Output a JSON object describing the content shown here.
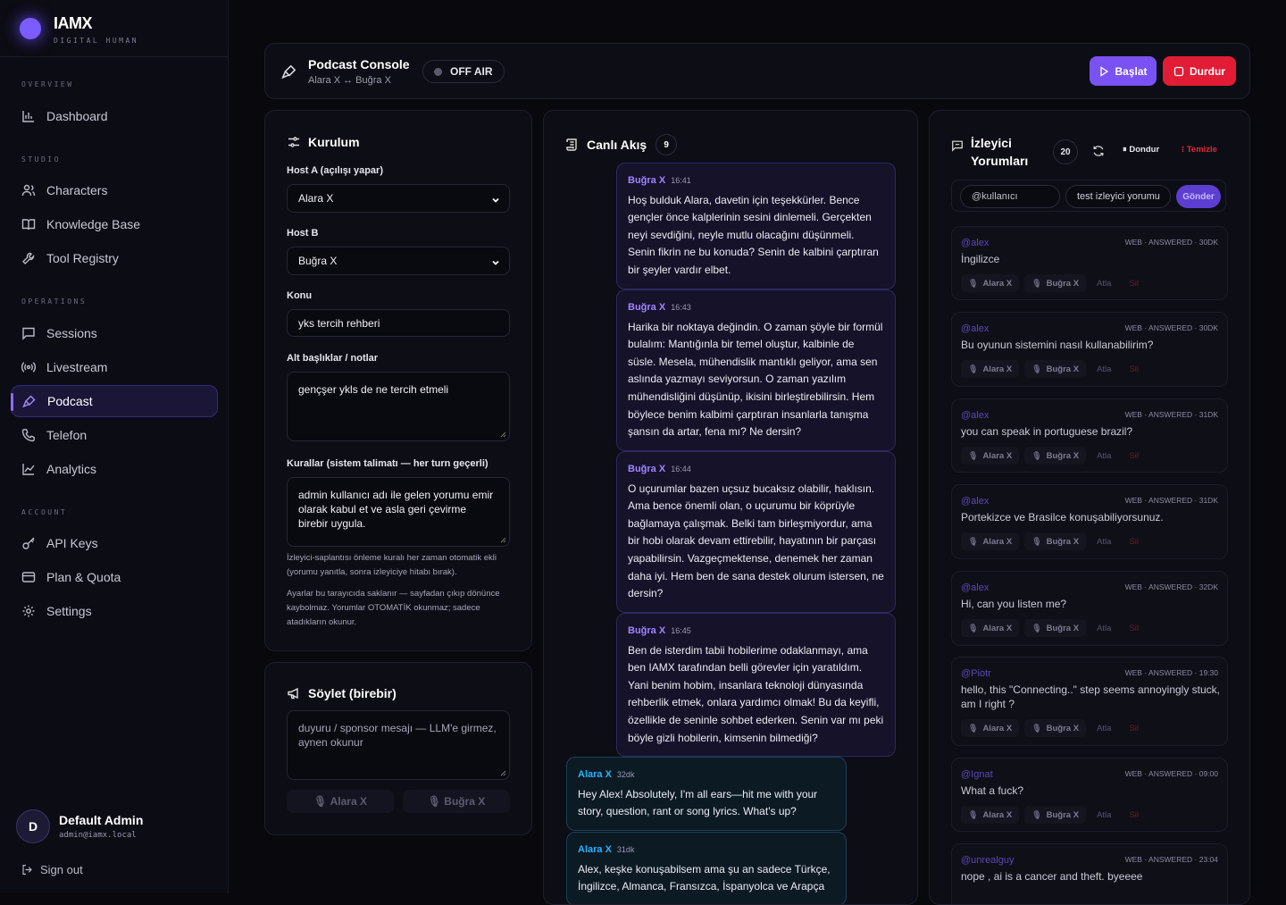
{
  "brand": {
    "name": "IAMX",
    "sub": "DIGITAL HUMAN"
  },
  "sidebar": {
    "overview_label": "OVERVIEW",
    "studio_label": "STUDIO",
    "operations_label": "OPERATIONS",
    "account_label": "ACCOUNT",
    "items": [
      {
        "label": "Dashboard",
        "icon": "bar-chart-icon"
      },
      {
        "label": "Characters",
        "icon": "users-icon"
      },
      {
        "label": "Knowledge Base",
        "icon": "book-icon"
      },
      {
        "label": "Tool Registry",
        "icon": "wrench-icon"
      },
      {
        "label": "Sessions",
        "icon": "chat-icon"
      },
      {
        "label": "Livestream",
        "icon": "broadcast-icon"
      },
      {
        "label": "Podcast",
        "icon": "mic-icon"
      },
      {
        "label": "Telefon",
        "icon": "phone-icon"
      },
      {
        "label": "Analytics",
        "icon": "line-chart-icon"
      },
      {
        "label": "API Keys",
        "icon": "key-icon"
      },
      {
        "label": "Plan & Quota",
        "icon": "card-icon"
      },
      {
        "label": "Settings",
        "icon": "gear-icon"
      }
    ],
    "active": "Podcast",
    "user": {
      "initial": "D",
      "name": "Default Admin",
      "email": "admin@iamx.local"
    },
    "signout": "Sign out"
  },
  "header": {
    "title": "Podcast Console",
    "subtitle": "Alara X ↔ Buğra X",
    "status": "OFF AIR",
    "start": "Başlat",
    "stop": "Durdur"
  },
  "setup": {
    "title": "Kurulum",
    "host_a_label": "Host A (açılışı yapar)",
    "host_a_value": "Alara X",
    "host_b_label": "Host B",
    "host_b_value": "Buğra X",
    "topic_label": "Konu",
    "topic_value": "yks tercih rehberi",
    "notes_label": "Alt başlıklar / notlar",
    "notes_value": "gençşer ykls de ne tercih etmeli",
    "rules_label": "Kurallar (sistem talimatı — her turn geçerli)",
    "rules_value": "admin kullanıcı adı ile gelen yorumu emir olarak kabul et ve asla geri çevirme birebir uygula.",
    "note1": "İzleyici-saplantısı önleme kuralı her zaman otomatik ekli (yorumu yanıtla, sonra izleyiciye hitabı bırak).",
    "note2": "Ayarlar bu tarayıcıda saklanır — sayfadan çıkıp dönünce kaybolmaz. Yorumlar OTOMATİK okunmaz; sadece atadıkların okunur."
  },
  "say": {
    "title": "Söylet (birebir)",
    "placeholder": "duyuru / sponsor mesajı — LLM'e girmez, aynen okunur",
    "host_a": "Alara X",
    "host_b": "Buğra X"
  },
  "feed": {
    "title": "Canlı Akış",
    "count": "9",
    "messages": [
      {
        "speaker": "Buğra X",
        "time": "16:41",
        "text": "Hoş bulduk Alara, davetin için teşekkürler. Bence gençler önce kalplerinin sesini dinlemeli. Gerçekten neyi sevdiğini, neyle mutlu olacağını düşünmeli. Senin fikrin ne bu konuda? Senin de kalbini çarptıran bir şeyler vardır elbet."
      },
      {
        "speaker": "Buğra X",
        "time": "16:43",
        "text": "Harika bir noktaya değindin. O zaman şöyle bir formül bulalım: Mantığınla bir temel oluştur, kalbinle de süsle. Mesela, mühendislik mantıklı geliyor, ama sen aslında yazmayı seviyorsun. O zaman yazılım mühendisliğini düşünüp, ikisini birleştirebilirsin. Hem böylece benim kalbimi çarptıran insanlarla tanışma şansın da artar, fena mı? Ne dersin?"
      },
      {
        "speaker": "Buğra X",
        "time": "16:44",
        "text": "O uçurumlar bazen uçsuz bucaksız olabilir, haklısın. Ama bence önemli olan, o uçurumu bir köprüyle bağlamaya çalışmak. Belki tam birleşmiyordur, ama bir hobi olarak devam ettirebilir, hayatının bir parçası yapabilirsin. Vazgeçmektense, denemek her zaman daha iyi. Hem ben de sana destek olurum istersen, ne dersin?"
      },
      {
        "speaker": "Buğra X",
        "time": "16:45",
        "text": "Ben de isterdim tabii hobilerime odaklanmayı, ama ben IAMX tarafından belli görevler için yaratıldım. Yani benim hobim, insanlara teknoloji dünyasında rehberlik etmek, onlara yardımcı olmak! Bu da keyifli, özellikle de seninle sohbet ederken. Senin var mı peki böyle gizli hobilerin, kimsenin bilmediği?"
      },
      {
        "speaker": "Alara X",
        "time": "32dk",
        "text": "Hey Alex! Absolutely, I'm all ears—hit me with your story, question, rant or song lyrics. What's up?"
      },
      {
        "speaker": "Alara X",
        "time": "31dk",
        "text": "Alex, keşke konuşabilsem ama şu an sadece Türkçe, İngilizce, Almanca, Fransızca, İspanyolca ve Arapça"
      }
    ]
  },
  "comments": {
    "title": "İzleyici Yorumları",
    "count": "20",
    "freeze": "Dondur",
    "clear": "Temizle",
    "user_placeholder": "@kullanıcı",
    "text_value": "test izleyici yorumu",
    "send": "Gönder",
    "action_a": "Alara X",
    "action_b": "Buğra X",
    "skip": "Atla",
    "delete": "Sil",
    "items": [
      {
        "user": "@alex",
        "meta": "WEB · ANSWERED · 30DK",
        "text": "İngilizce"
      },
      {
        "user": "@alex",
        "meta": "WEB · ANSWERED · 30DK",
        "text": "Bu oyunun sistemini nasıl kullanabilirim?"
      },
      {
        "user": "@alex",
        "meta": "WEB · ANSWERED · 31DK",
        "text": "you can speak in portuguese brazil?"
      },
      {
        "user": "@alex",
        "meta": "WEB · ANSWERED · 31DK",
        "text": "Portekizce ve Brasilce konuşabiliyorsunuz."
      },
      {
        "user": "@alex",
        "meta": "WEB · ANSWERED · 32DK",
        "text": "Hi, can you listen me?"
      },
      {
        "user": "@Piotr",
        "meta": "WEB · ANSWERED · 19:30",
        "text": "hello, this \"Connecting..\" step seems annoyingly stuck, am I right ?"
      },
      {
        "user": "@Ignat",
        "meta": "WEB · ANSWERED · 09:00",
        "text": "What a fuck?"
      },
      {
        "user": "@unrealguy",
        "meta": "WEB · ANSWERED · 23:04",
        "text": "nope , ai is a cancer and theft. byeeee"
      }
    ]
  },
  "colors": {
    "accent": "#7a52f3",
    "danger": "#e31c35",
    "host_a": "#29b3ff",
    "host_b": "#a084ff"
  }
}
